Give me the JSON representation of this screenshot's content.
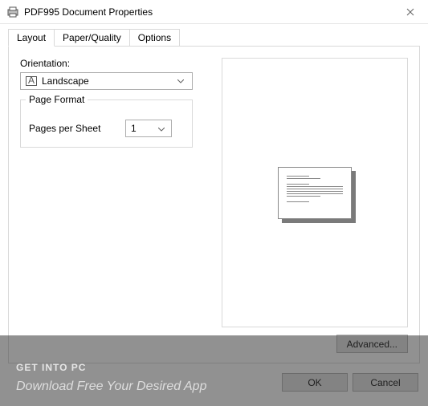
{
  "window": {
    "title": "PDF995 Document Properties"
  },
  "tabs": {
    "layout": "Layout",
    "paper_quality": "Paper/Quality",
    "options": "Options"
  },
  "orientation": {
    "label": "Orientation:",
    "value": "Landscape"
  },
  "page_format": {
    "legend": "Page Format",
    "pages_per_sheet_label": "Pages per Sheet",
    "pages_per_sheet_value": "1"
  },
  "buttons": {
    "advanced": "Advanced...",
    "ok": "OK",
    "cancel": "Cancel"
  },
  "watermark": {
    "line1a": "GET ",
    "line1b": "INTO ",
    "line1c": "PC",
    "line2": "Download Free Your Desired App"
  }
}
